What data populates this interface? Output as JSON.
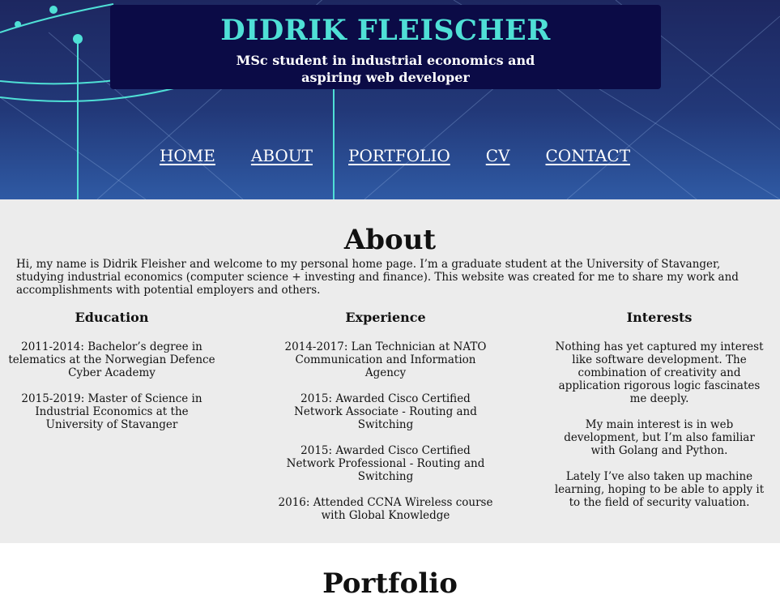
{
  "header": {
    "name": "DIDRIK FLEISCHER",
    "tagline": "MSc student in industrial economics and aspiring web developer"
  },
  "nav": {
    "items": [
      {
        "label": "HOME"
      },
      {
        "label": "ABOUT"
      },
      {
        "label": "PORTFOLIO"
      },
      {
        "label": "CV"
      },
      {
        "label": "CONTACT"
      }
    ]
  },
  "about": {
    "title": "About",
    "intro": "Hi, my name is Didrik Fleisher and welcome to my personal home page. I’m a graduate student at the University of Stavanger, studying industrial economics (computer science + investing and finance). This website was created for me to share my work and accomplishments with potential employers and others.",
    "education": {
      "heading": "Education",
      "items": [
        "2011-2014: Bachelor’s degree in telematics at the Norwegian Defence Cyber Academy",
        "2015-2019: Master of Science in Industrial Economics at the University of Stavanger"
      ]
    },
    "experience": {
      "heading": "Experience",
      "items": [
        "2014-2017: Lan Technician at NATO Communication and Information Agency",
        "2015: Awarded Cisco Certified Network Associate - Routing and Switching",
        "2015: Awarded Cisco Certified Network Professional - Routing and Switching",
        "2016: Attended CCNA Wireless course with Global Knowledge"
      ]
    },
    "interests": {
      "heading": "Interests",
      "items": [
        "Nothing has yet captured my interest like software development. The combination of creativity and application rigorous logic fascinates me deeply.",
        "My main interest is in web development, but I’m also familiar with Golang and Python.",
        "Lately I’ve also taken up machine learning, hoping to be able to apply it to the field of security valuation."
      ]
    }
  },
  "portfolio": {
    "title": "Portfolio"
  },
  "colors": {
    "accent": "#4fe0d6",
    "title_box": "#0b0b46",
    "section_bg": "#ececec"
  }
}
